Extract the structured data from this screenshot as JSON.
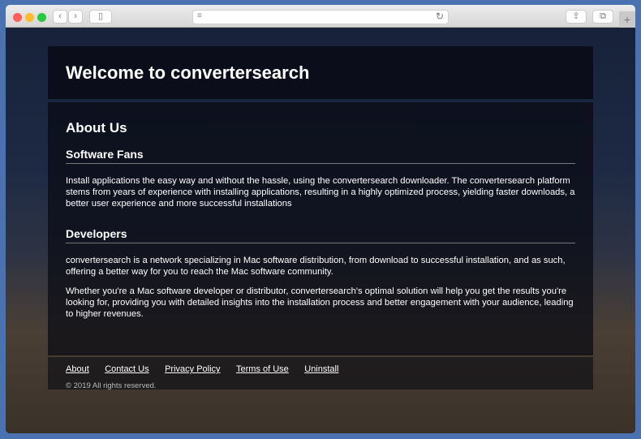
{
  "header": {
    "title": "Welcome to convertersearch"
  },
  "main": {
    "heading": "About Us",
    "sections": [
      {
        "title": "Software Fans",
        "paragraphs": [
          "Install applications the easy way and without the hassle, using the convertersearch downloader. The convertersearch platform stems from years of experience with installing applications, resulting in a highly optimized process, yielding faster downloads, a better user experience and more successful installations"
        ]
      },
      {
        "title": "Developers",
        "paragraphs": [
          "convertersearch is a network specializing in Mac software distribution, from download to successful installation, and as such, offering a better way for you to reach the Mac software community.",
          "Whether you're a Mac software developer or distributor, convertersearch's optimal solution will help you get the results you're looking for, providing you with detailed insights into the installation process and better engagement with your audience, leading to higher revenues."
        ]
      }
    ]
  },
  "footer": {
    "links": [
      "About",
      "Contact Us",
      "Privacy Policy",
      "Terms of Use",
      "Uninstall"
    ],
    "copyright": "© 2019 All rights reserved."
  }
}
